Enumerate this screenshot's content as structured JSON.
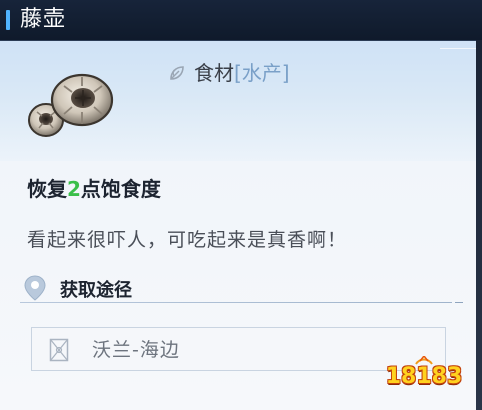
{
  "window": {
    "title": "藤壶"
  },
  "item": {
    "category": "食材",
    "subcategory": "[水产]",
    "effect_prefix": "恢复",
    "effect_value": "2",
    "effect_suffix": "点饱食度",
    "description": "看起来很吓人，可吃起来是真香啊！",
    "icon": "barnacle-icon",
    "category_icon": "leaf-icon"
  },
  "source": {
    "header": "获取途径",
    "header_icon": "location-pin-icon",
    "location": "沃兰-海边",
    "location_icon": "map-icon"
  },
  "watermark": {
    "text": "18183"
  },
  "colors": {
    "accent": "#4fb3ff",
    "effect_value": "#3bbf4a",
    "subcategory": "#7aa0c8"
  }
}
